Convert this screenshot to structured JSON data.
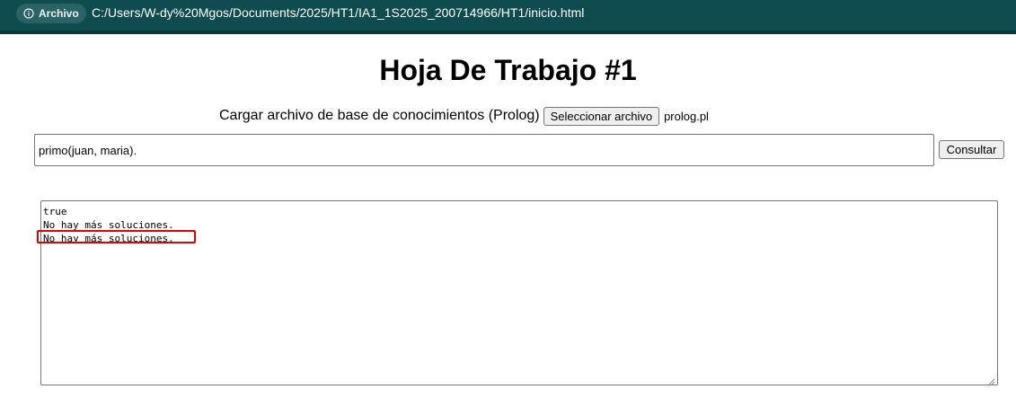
{
  "browser": {
    "site_chip_label": "Archivo",
    "url": "C:/Users/W-dy%20Mgos/Documents/2025/HT1/IA1_1S2025_200714966/HT1/inicio.html",
    "icons": {
      "site_info": "info-icon"
    }
  },
  "page": {
    "title": "Hoja De Trabajo #1",
    "upload": {
      "label": "Cargar archivo de base de conocimientos (Prolog)",
      "button_label": "Seleccionar archivo",
      "file_name": "prolog.pl"
    },
    "query": {
      "value": "primo(juan, maria).",
      "button_label": "Consultar"
    },
    "result": {
      "lines": [
        "true",
        "No hay más soluciones.",
        "No hay más soluciones."
      ]
    }
  },
  "colors": {
    "browser_bar": "#0f4c4f",
    "highlight": "#e00000"
  }
}
